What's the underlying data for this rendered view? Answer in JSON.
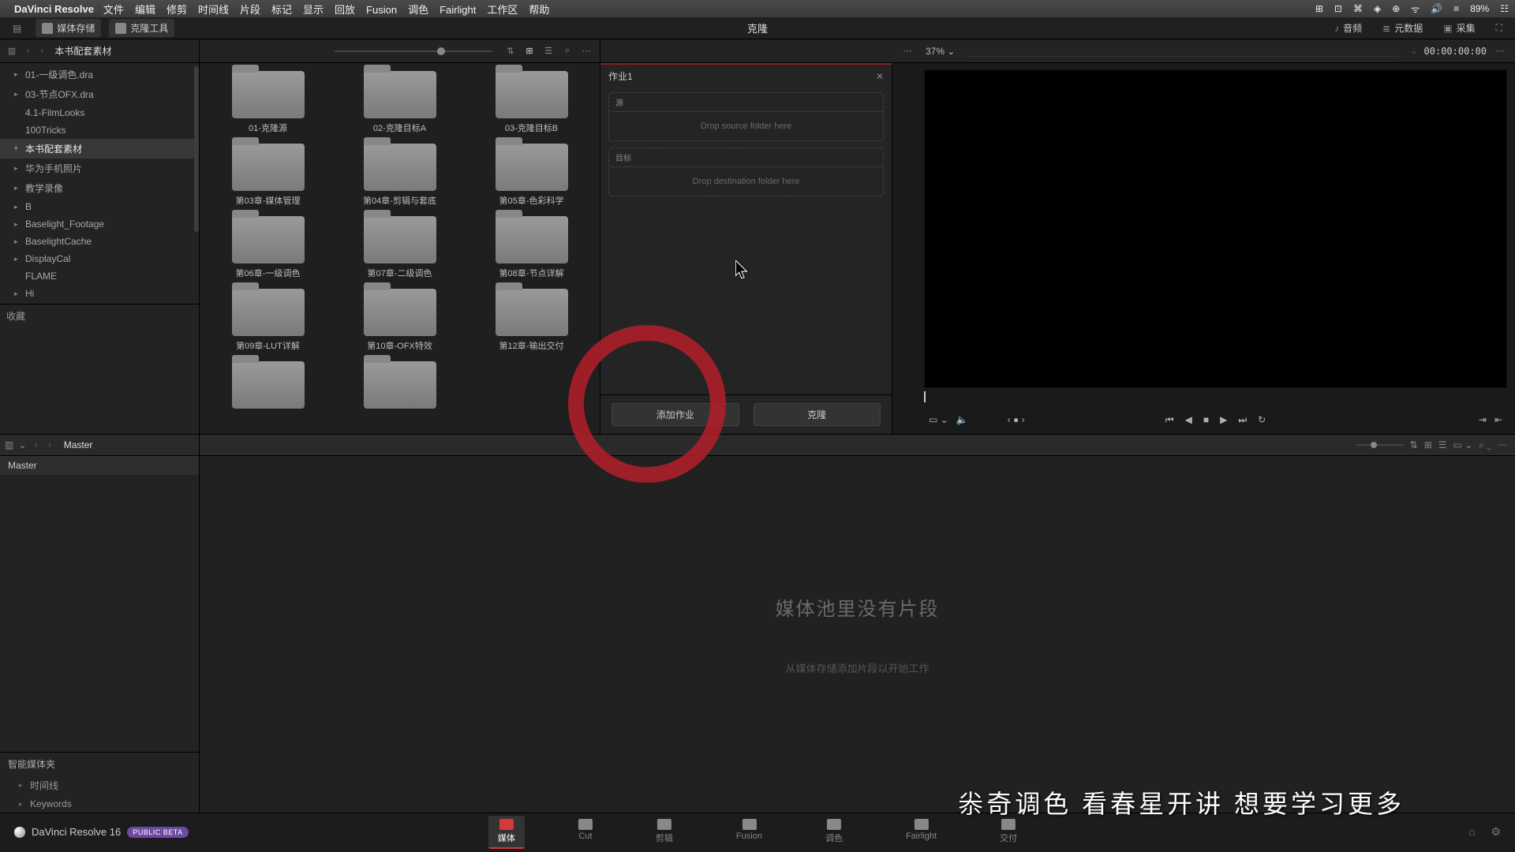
{
  "menubar": {
    "app": "DaVinci Resolve",
    "items": [
      "文件",
      "编辑",
      "修剪",
      "时间线",
      "片段",
      "标记",
      "显示",
      "回放",
      "Fusion",
      "调色",
      "Fairlight",
      "工作区",
      "帮助"
    ],
    "status": [
      "⊞",
      "⊡",
      "⌘",
      "◈",
      "⊕",
      "ᯤ",
      "🔊",
      "≡",
      "89%",
      "☷"
    ]
  },
  "toolbar": {
    "media_storage": "媒体存储",
    "clone_tool": "克隆工具",
    "title": "克隆",
    "audio": "音频",
    "metadata": "元数据",
    "capture": "采集"
  },
  "secbar": {
    "path": "本书配套素材",
    "zoom": "37%",
    "chev": "⌄",
    "timecode": "00:00:00:00"
  },
  "tree": [
    {
      "label": "01-一级调色.dra",
      "exp": false
    },
    {
      "label": "03-节点OFX.dra",
      "exp": false
    },
    {
      "label": "4.1-FilmLooks"
    },
    {
      "label": "100Tricks"
    },
    {
      "label": "本书配套素材",
      "exp": true,
      "sel": true
    },
    {
      "label": "华为手机照片",
      "exp": false
    },
    {
      "label": "教学录像",
      "exp": false
    },
    {
      "label": "B",
      "exp": false
    },
    {
      "label": "Baselight_Footage",
      "exp": false
    },
    {
      "label": "BaselightCache",
      "exp": false
    },
    {
      "label": "DisplayCal",
      "exp": false
    },
    {
      "label": "FLAME"
    },
    {
      "label": "Hi",
      "exp": false
    }
  ],
  "favorites_label": "收藏",
  "folders": [
    "01-克隆源",
    "02-克隆目标A",
    "03-克隆目标B",
    "第03章-媒体管理",
    "第04章-剪辑与套底",
    "第05章-色彩科学",
    "第06章-一级调色",
    "第07章-二级调色",
    "第08章-节点详解",
    "第09章-LUT详解",
    "第10章-OFX特效",
    "第12章-输出交付",
    "",
    ""
  ],
  "clone": {
    "job": "作业1",
    "src_label": "源",
    "src_msg": "Drop source folder here",
    "dst_label": "目标",
    "dst_msg": "Drop destination folder here",
    "add_job": "添加作业",
    "clone_btn": "克隆"
  },
  "master": {
    "label": "Master",
    "tab": "Master"
  },
  "smart_bins": {
    "label": "智能媒体夹",
    "items": [
      "时间线",
      "Keywords"
    ]
  },
  "media_pool": {
    "empty_title": "媒体池里没有片段",
    "empty_sub": "从媒体存储添加片段以开始工作"
  },
  "bottom": {
    "brand": "DaVinci Resolve 16",
    "badge": "PUBLIC BETA",
    "pages": [
      {
        "label": "媒体",
        "active": true
      },
      {
        "label": "Cut"
      },
      {
        "label": "剪辑"
      },
      {
        "label": "Fusion"
      },
      {
        "label": "调色"
      },
      {
        "label": "Fairlight"
      },
      {
        "label": "交付"
      }
    ]
  },
  "subtitle": "尜奇调色 看春星开讲 想要学习更多"
}
